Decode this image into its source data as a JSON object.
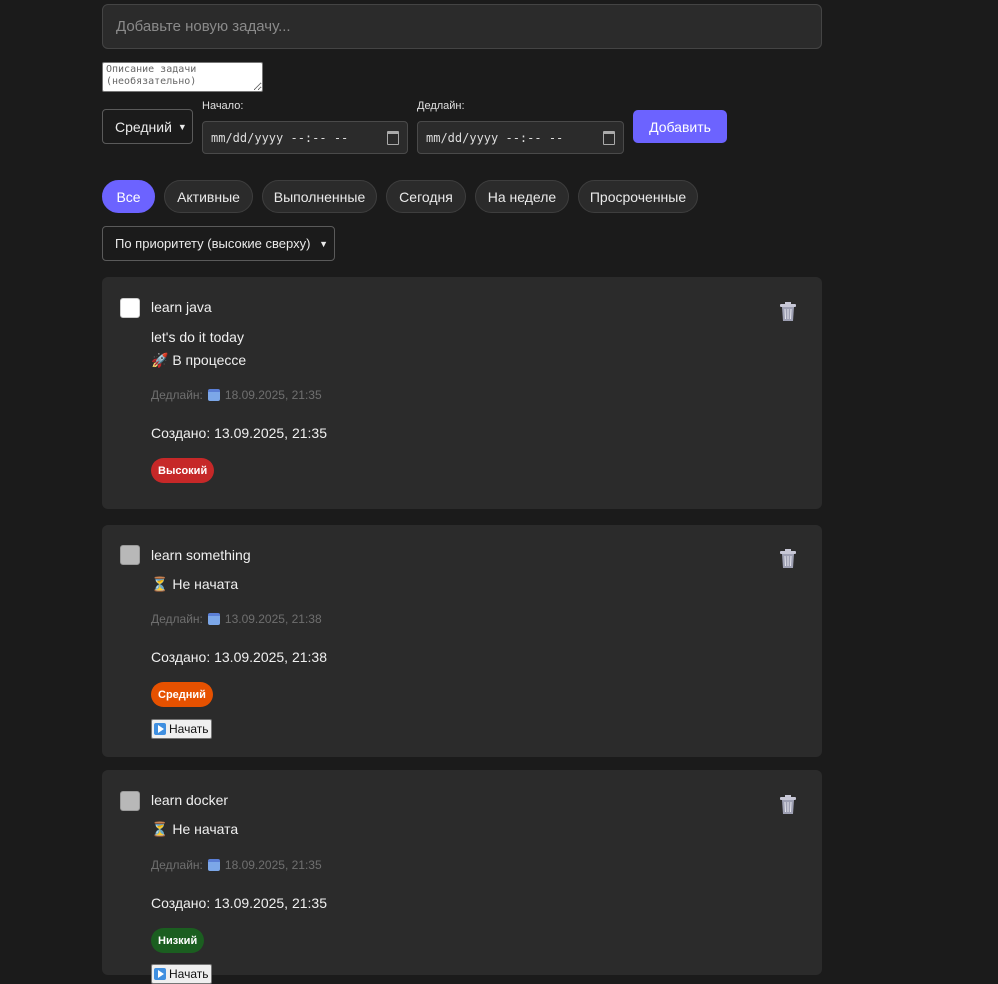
{
  "form": {
    "task_placeholder": "Добавьте новую задачу...",
    "description_placeholder": "Описание задачи (необязательно)",
    "priority_value": "Средний",
    "start_label": "Начало:",
    "start_value": "mm/dd/yyyy --:-- --",
    "deadline_label": "Дедлайн:",
    "deadline_value": "mm/dd/yyyy --:-- --",
    "add_label": "Добавить"
  },
  "filters": [
    {
      "label": "Все",
      "active": true
    },
    {
      "label": "Активные"
    },
    {
      "label": "Выполненные"
    },
    {
      "label": "Сегодня"
    },
    {
      "label": "На неделе"
    },
    {
      "label": "Просроченные"
    }
  ],
  "sort_value": "По приоритету (высокие сверху)",
  "tasks": [
    {
      "title": "learn java",
      "description": "let's do it today",
      "status_icon": "rocket-icon",
      "status": "В процессе",
      "deadline_label": "Дедлайн:",
      "deadline": "18.09.2025, 21:35",
      "created": "Создано: 13.09.2025, 21:35",
      "priority": "Высокий",
      "priority_color": "#c62828"
    },
    {
      "title": "learn something",
      "status_icon": "hourglass-icon",
      "status": "Не начата",
      "deadline_label": "Дедлайн:",
      "deadline": "13.09.2025, 21:38",
      "created": "Создано: 13.09.2025, 21:38",
      "priority": "Средний",
      "priority_color": "#e65100",
      "start_label": "Начать"
    },
    {
      "title": "learn docker",
      "status_icon": "hourglass-icon",
      "status": "Не начата",
      "deadline_label": "Дедлайн:",
      "deadline": "18.09.2025, 21:35",
      "created": "Создано: 13.09.2025, 21:35",
      "priority": "Низкий",
      "priority_color": "#1b5e20",
      "start_label": "Начать"
    }
  ],
  "colors": {
    "accent": "#6c63ff",
    "background": "#1b1b1b",
    "card": "#2b2b2b"
  }
}
